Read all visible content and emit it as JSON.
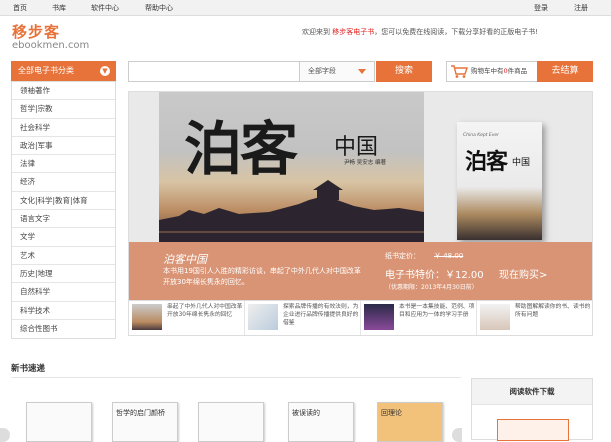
{
  "topnav": {
    "home": "首页",
    "library": "书库",
    "software": "软件中心",
    "help": "帮助中心",
    "login": "登录",
    "register": "注册"
  },
  "logo": {
    "cn": "移步客",
    "en": "ebookmen.com"
  },
  "welcome": {
    "pre": "欢迎来到 ",
    "site": "移步客电子书",
    "post": "，您可以免费在线阅读，下载分享好看的正版电子书!"
  },
  "categories": {
    "header": "全部电子书分类",
    "items": [
      "领袖著作",
      "哲学|宗教",
      "社会科学",
      "政治|军事",
      "法律",
      "经济",
      "文化|科学|教育|体育",
      "语言文字",
      "文学",
      "艺术",
      "历史|地理",
      "自然科学",
      "科学技术",
      "综合性图书"
    ]
  },
  "search": {
    "placeholder": "",
    "field": "全部字段",
    "button": "搜索"
  },
  "cart": {
    "pre": "购物车中有",
    "count": "0",
    "post": "件商品",
    "checkout": "去结算"
  },
  "banner": {
    "title_main": "泊客",
    "title_sub": "中国",
    "author": "尹畅   吴安志  编著",
    "cover_en": "China Kept Ever",
    "cover_cn": "泊客",
    "cover_cn2": "中国",
    "subtitle": "泊客中国",
    "description": "本书用19国引人入胜的精彩访谈，串起了中外几代人对中国改革开放30年绵长隽永的回忆。",
    "paper_price_label": "纸书定价：",
    "paper_price": "￥ 48.00",
    "ebook_price": "电子书特价：￥12.00",
    "buy_now": "现在购买>",
    "limit_note": "（优惠期限：2013年4月30日前）"
  },
  "thumbs": [
    {
      "text": "串起了中外几代人对中国改革开放30年绵长隽永的回忆"
    },
    {
      "text": "探索品牌传播的有效法则，为企业进行品牌传播提供良好的借鉴"
    },
    {
      "text": "本书是一本集技能、范例、项目和应用为一体的学习手册"
    },
    {
      "text": "帮助图解解读你的书、读书的所有问题"
    }
  ],
  "newbooks": {
    "title": "新书速递",
    "books": [
      {
        "text": ""
      },
      {
        "text": "哲学的启门颜桥"
      },
      {
        "text": ""
      },
      {
        "text": "被误读的"
      },
      {
        "text": "回理论"
      }
    ]
  },
  "reader": {
    "title": "阅读软件下载"
  },
  "colors": {
    "accent": "#e8733a",
    "highlight": "#e02020",
    "banner_info": "#d99475"
  }
}
